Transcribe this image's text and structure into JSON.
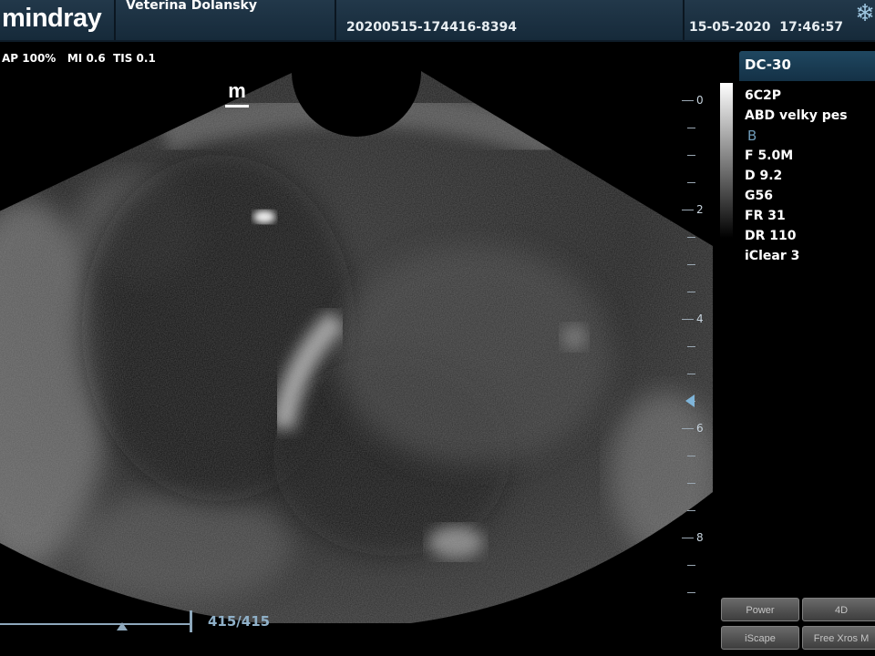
{
  "header": {
    "logo": "mindray",
    "hospital": "Veterina Dolansky",
    "exam_id": "20200515-174416-8394",
    "datetime": "15-05-2020  17:46:57",
    "freeze_icon": "snowflake-icon"
  },
  "acoustic": "AP 100%   MI 0.6  TIS 0.1",
  "orientation_marker": "m",
  "depth_scale": {
    "labels": [
      "0",
      "2",
      "4",
      "6",
      "8"
    ]
  },
  "panel": {
    "model": "DC-30",
    "probe": "6C2P",
    "preset": "ABD velky pes",
    "mode": "B",
    "frequency": "F 5.0M",
    "depth": "D 9.2",
    "gain": "G56",
    "frame_rate": "FR 31",
    "dynamic_range": "DR 110",
    "iclear": "iClear 3"
  },
  "cine": {
    "count": "415/415"
  },
  "buttons": {
    "power": "Power",
    "four_d": "4D",
    "iscape": "iScape",
    "free_xros": "Free Xros M"
  },
  "colors": {
    "header_bg": "#1a3143",
    "accent": "#7fb4d8",
    "button_bg": "#555555"
  }
}
